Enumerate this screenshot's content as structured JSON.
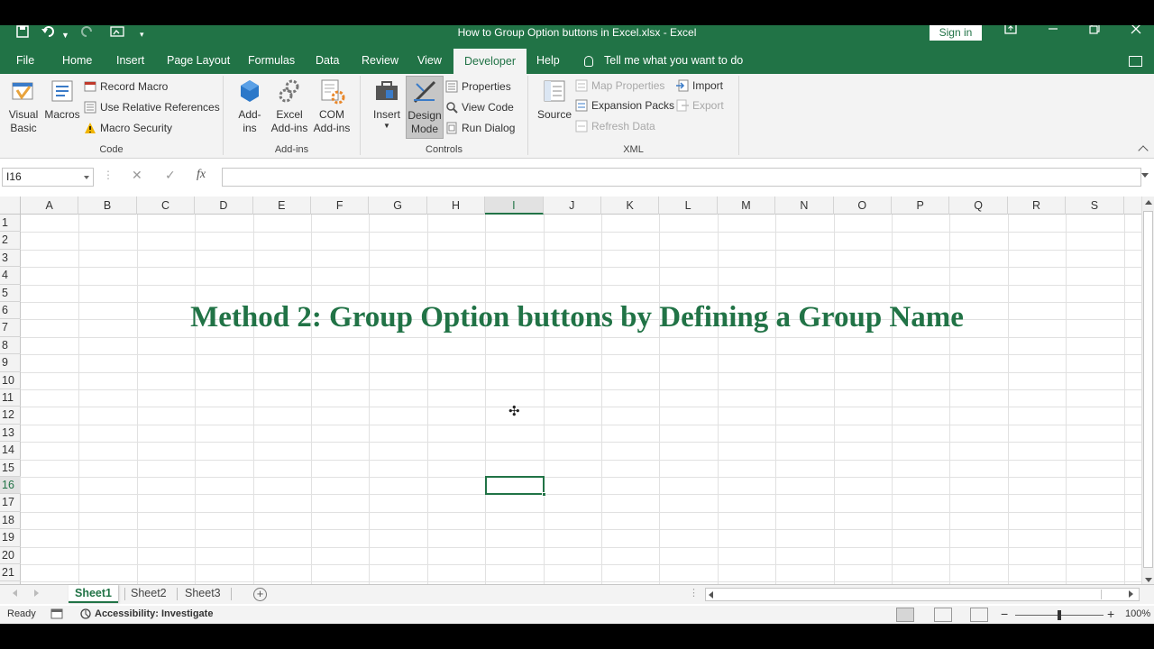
{
  "window": {
    "title": "How to Group Option buttons in Excel.xlsx  -  Excel",
    "sign_in": "Sign in"
  },
  "tabs": [
    {
      "label": "File"
    },
    {
      "label": "Home"
    },
    {
      "label": "Insert"
    },
    {
      "label": "Page Layout"
    },
    {
      "label": "Formulas"
    },
    {
      "label": "Data"
    },
    {
      "label": "Review"
    },
    {
      "label": "View"
    },
    {
      "label": "Developer"
    },
    {
      "label": "Help"
    }
  ],
  "active_tab": "Developer",
  "tell_me": "Tell me what you want to do",
  "ribbon": {
    "code": {
      "label": "Code",
      "visual_basic": "Visual\nBasic",
      "macros": "Macros",
      "record_macro": "Record Macro",
      "relative_refs": "Use Relative References",
      "macro_security": "Macro Security"
    },
    "addins": {
      "label": "Add-ins",
      "addins": "Add-\nins",
      "excel_addins": "Excel\nAdd-ins",
      "com_addins": "COM\nAdd-ins"
    },
    "controls": {
      "label": "Controls",
      "insert": "Insert",
      "design_mode": "Design\nMode",
      "properties": "Properties",
      "view_code": "View Code",
      "run_dialog": "Run Dialog"
    },
    "xml": {
      "label": "XML",
      "source": "Source",
      "map_properties": "Map Properties",
      "expansion_packs": "Expansion Packs",
      "refresh_data": "Refresh Data",
      "import": "Import",
      "export": "Export"
    }
  },
  "formula_bar": {
    "name_box": "I16",
    "cancel": "✕",
    "enter": "✓",
    "fx": "fx",
    "value": ""
  },
  "columns": [
    "A",
    "B",
    "C",
    "D",
    "E",
    "F",
    "G",
    "H",
    "I",
    "J",
    "K",
    "L",
    "M",
    "N",
    "O",
    "P",
    "Q",
    "R",
    "S"
  ],
  "selected_column": "I",
  "rows": [
    "1",
    "2",
    "3",
    "4",
    "5",
    "6",
    "7",
    "8",
    "9",
    "10",
    "11",
    "12",
    "13",
    "14",
    "15",
    "16",
    "17",
    "18",
    "19",
    "20",
    "21"
  ],
  "selected_row": "16",
  "sheet_heading": "Method 2: Group Option buttons by Defining a Group Name",
  "sheets": [
    {
      "label": "Sheet1",
      "active": true
    },
    {
      "label": "Sheet2",
      "active": false
    },
    {
      "label": "Sheet3",
      "active": false
    }
  ],
  "status": {
    "ready": "Ready",
    "accessibility": "Accessibility: Investigate",
    "zoom": "100%",
    "minus": "−",
    "plus": "+"
  },
  "colors": {
    "excel_green": "#217346"
  }
}
